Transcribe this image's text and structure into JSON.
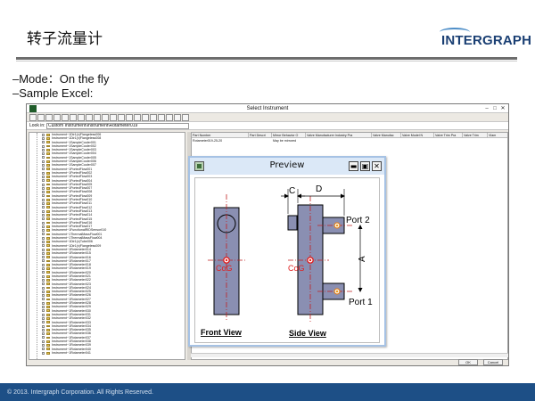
{
  "slide": {
    "title": "转子流量计",
    "logo": "INTERGRAPH",
    "bullets": [
      "–Mode：On the fly",
      "–Sample Excel:"
    ],
    "footer": "© 2013. Intergraph Corporation. All Rights Reserved."
  },
  "app_window": {
    "title": "Select Instrument",
    "path_label": "Look in:",
    "path_value": "Custom Instrument\\Instrument\\Rotameter019",
    "tree_items": [
      "Instrument~1Dir1(x)Flangeless006",
      "Instrument~1Dir1(x)Flangeless008",
      "Instrument~1SampleCooler001",
      "Instrument~1SampleCooler002",
      "Instrument~1SampleCooler003",
      "Instrument~1SampleCooler004",
      "Instrument~1SampleCooler005",
      "Instrument~1SampleCooler006",
      "Instrument~1SampleCooler007",
      "Instrument~1PortedFlow001",
      "Instrument~1PortedFlow002",
      "Instrument~1PortedFlow003",
      "Instrument~1PortedFlow004",
      "Instrument~1PortedFlow005",
      "Instrument~1PortedFlow007",
      "Instrument~1PortedFlow008",
      "Instrument~1PortedFlow009",
      "Instrument~1PortedFlow010",
      "Instrument~1PortedFlow011",
      "Instrument~1PortedFlow012",
      "Instrument~1PortedFlow013",
      "Instrument~1PortedFlow014",
      "Instrument~1PortedFlow015",
      "Instrument~1PortedFlow016",
      "Instrument~1PortedFlow017",
      "Instrument~1FunctionalRIDSensor010",
      "Instrument~1ThermalMassFlow001",
      "Instrument~1ThermalMassFlow004",
      "Instrument~1Dir1(x)Tube006",
      "Instrument~1Dir1(x)Flangeless009",
      "Instrument~1Rotameter014",
      "Instrument~1Rotameter015",
      "Instrument~1Rotameter016",
      "Instrument~1Rotameter017",
      "Instrument~1Rotameter018",
      "Instrument~1Rotameter019",
      "Instrument~1Rotameter020",
      "Instrument~1Rotameter021",
      "Instrument~1Rotameter022",
      "Instrument~1Rotameter023",
      "Instrument~1Rotameter024",
      "Instrument~1Rotameter025",
      "Instrument~1Rotameter026",
      "Instrument~1Rotameter027",
      "Instrument~1Rotameter028",
      "Instrument~1Rotameter029",
      "Instrument~1Rotameter030",
      "Instrument~1Rotameter031",
      "Instrument~1Rotameter032",
      "Instrument~1Rotameter033",
      "Instrument~1Rotameter034",
      "Instrument~1Rotameter035",
      "Instrument~1Rotameter036",
      "Instrument~1Rotameter037",
      "Instrument~1Rotameter038",
      "Instrument~1Rotameter039",
      "Instrument~1Rotameter040",
      "Instrument~1Rotameter041"
    ],
    "grid_columns": [
      "Part Number",
      "Part Descri",
      "Mirror Behavior O",
      "Valve Manufacturer Industry Pra",
      "Valve Manufac",
      "Valve Model N",
      "Valve Trim Pra",
      "Valve Trim",
      "Vlam"
    ],
    "grid_row": [
      "Rotameter019-25-20",
      "",
      "May be mirrored",
      "",
      "",
      "",
      "",
      "",
      ""
    ],
    "ok_label": "OK",
    "cancel_label": "Cancel"
  },
  "preview": {
    "title": "Preview",
    "minimize": "▬",
    "maximize": "▣",
    "close": "✕",
    "labels": {
      "c": "C",
      "d": "D",
      "a": "A",
      "port1": "Port 1",
      "port2": "Port 2",
      "cog_front": "CoG",
      "cog_side": "CoG",
      "front_view": "Front View",
      "side_view": "Side View"
    }
  },
  "colors": {
    "body_fill": "#8a8fb2",
    "cog_red": "#e02020",
    "port_dot": "#f0a020",
    "footer_blue": "#1d4f86",
    "logo_blue": "#1a3f73"
  }
}
